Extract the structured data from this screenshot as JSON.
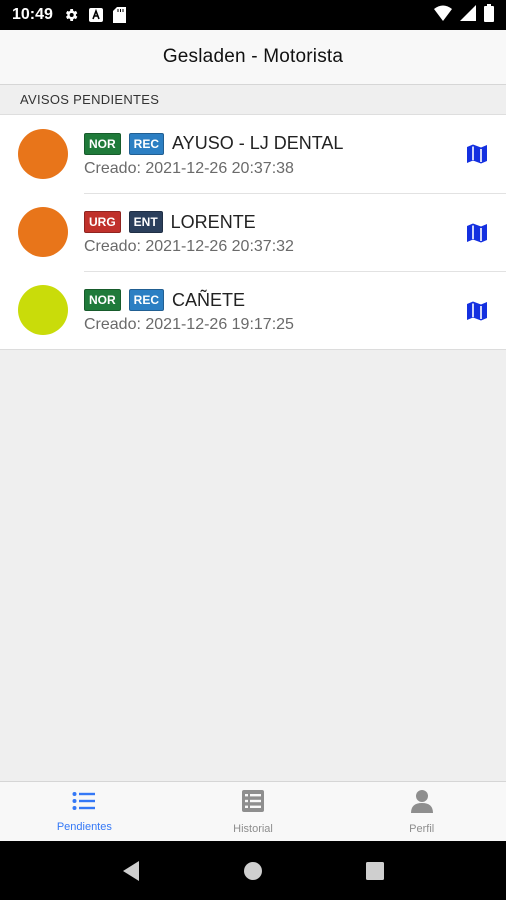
{
  "status_bar": {
    "time": "10:49",
    "left_icons": [
      "gear-icon",
      "a-badge-icon",
      "sd-card-icon"
    ],
    "right_icons": [
      "wifi-icon",
      "signal-icon",
      "battery-icon"
    ]
  },
  "header": {
    "title": "Gesladen - Motorista"
  },
  "section": {
    "title": "AVISOS PENDIENTES"
  },
  "items": [
    {
      "color": "#e8751a",
      "tags": [
        {
          "label": "NOR",
          "color": "#1f7a3a"
        },
        {
          "label": "REC",
          "color": "#2c7fc3"
        }
      ],
      "name": "AYUSO - LJ DENTAL",
      "created": "Creado: 2021-12-26 20:37:38",
      "action_icon": "map-icon"
    },
    {
      "color": "#e8751a",
      "tags": [
        {
          "label": "URG",
          "color": "#c0312b"
        },
        {
          "label": "ENT",
          "color": "#2b3f5c"
        }
      ],
      "name": "LORENTE",
      "created": "Creado: 2021-12-26 20:37:32",
      "action_icon": "map-icon"
    },
    {
      "color": "#c9dc0a",
      "tags": [
        {
          "label": "NOR",
          "color": "#1f7a3a"
        },
        {
          "label": "REC",
          "color": "#2c7fc3"
        }
      ],
      "name": "CAÑETE",
      "created": "Creado: 2021-12-26 19:17:25",
      "action_icon": "map-icon"
    }
  ],
  "tabs": [
    {
      "label": "Pendientes",
      "icon": "list-icon",
      "active": true
    },
    {
      "label": "Historial",
      "icon": "table-list-icon",
      "active": false
    },
    {
      "label": "Perfil",
      "icon": "person-icon",
      "active": false
    }
  ],
  "nav": [
    "back-icon",
    "home-icon",
    "recents-icon"
  ],
  "colors": {
    "accent": "#3478f6",
    "map_icon": "#1430e0"
  }
}
